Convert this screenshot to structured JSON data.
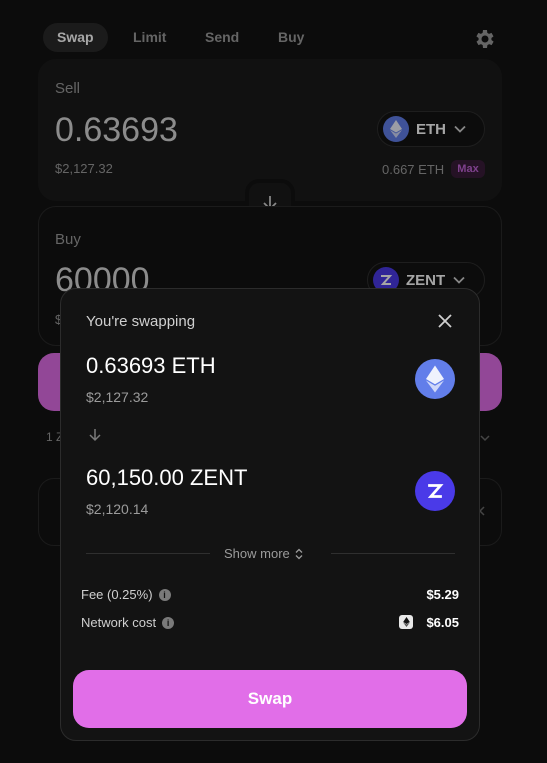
{
  "tabs": [
    "Swap",
    "Limit",
    "Send",
    "Buy"
  ],
  "sell": {
    "label": "Sell",
    "amount": "0.63693",
    "usd": "$2,127.32",
    "token": "ETH",
    "balance": "0.667 ETH",
    "max_label": "Max"
  },
  "buy": {
    "label": "Buy",
    "amount": "60000",
    "usd_partial": "$",
    "token": "ZENT"
  },
  "background_fragments": {
    "rate_partial": "1 Z"
  },
  "modal": {
    "title": "You're swapping",
    "from_amount": "0.63693 ETH",
    "from_usd": "$2,127.32",
    "to_amount": "60,150.00 ZENT",
    "to_usd": "$2,120.14",
    "show_more": "Show more",
    "fee_label": "Fee (0.25%)",
    "fee_value": "$5.29",
    "network_label": "Network cost",
    "network_value": "$6.05",
    "swap_label": "Swap"
  },
  "colors": {
    "accent": "#e16ee8",
    "eth": "#627eea",
    "zent": "#4a3ae8",
    "background": "#131313"
  },
  "icons": [
    "gear-icon",
    "chevron-down-icon",
    "arrow-down-icon",
    "close-icon",
    "info-icon",
    "eth-icon",
    "zent-icon",
    "chevron-updown-icon",
    "gas-icon"
  ]
}
